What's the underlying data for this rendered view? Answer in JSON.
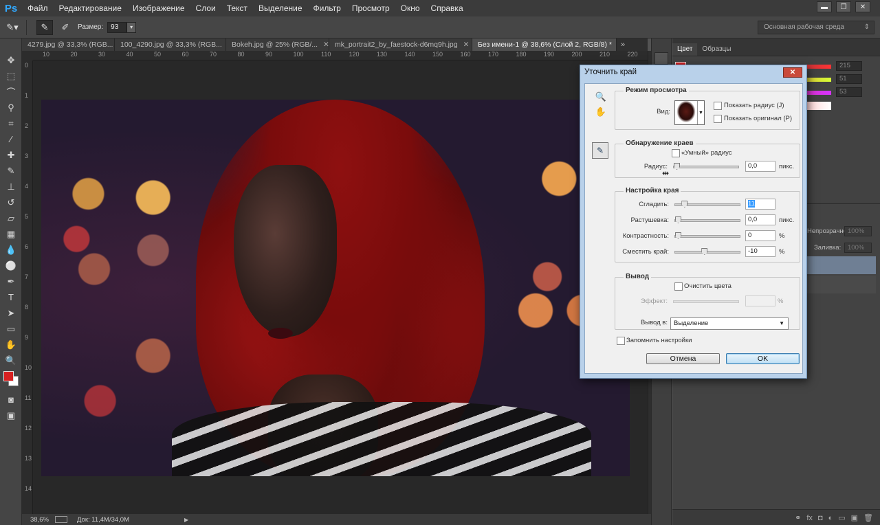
{
  "app": {
    "logo": "Ps",
    "menu": [
      "Файл",
      "Редактирование",
      "Изображение",
      "Слои",
      "Текст",
      "Выделение",
      "Фильтр",
      "Просмотр",
      "Окно",
      "Справка"
    ],
    "window_controls": [
      "▬",
      "❐",
      "✕"
    ]
  },
  "options_bar": {
    "size_label": "Размер:",
    "size_value": "93",
    "workspace": "Основная рабочая среда",
    "icons": [
      "brush-options-icon",
      "refine-radius-icon",
      "erase-refinements-icon"
    ]
  },
  "tabs": [
    {
      "label": "4279.jpg @ 33,3% (RGB...",
      "close": "✕"
    },
    {
      "label": "100_4290.jpg @ 33,3% (RGB...",
      "close": "✕"
    },
    {
      "label": "Bokeh.jpg @ 25% (RGB/...",
      "close": "✕"
    },
    {
      "label": "mk_portrait2_by_faestock-d6mq9h.jpg",
      "close": "✕"
    },
    {
      "label": "Без имени-1 @ 38,6% (Слой 2, RGB/8) *",
      "close": "✕"
    }
  ],
  "tabs_more": "»",
  "ruler_top_ticks": [
    "10",
    "20",
    "30",
    "40",
    "50",
    "60",
    "70",
    "80",
    "90",
    "100",
    "110",
    "120",
    "130",
    "140",
    "150",
    "160",
    "170",
    "180",
    "190",
    "200",
    "210",
    "220"
  ],
  "ruler_left_ticks": [
    "0",
    "1",
    "2",
    "3",
    "4",
    "5",
    "6",
    "7",
    "8",
    "9",
    "10",
    "11",
    "12",
    "13",
    "14"
  ],
  "status": {
    "zoom": "38,6%",
    "doc": "Док: 11,4M/34,0M",
    "arrow": "▶"
  },
  "panel": {
    "tabs": [
      "Цвет",
      "Образцы"
    ],
    "color_values": [
      "215",
      "51",
      "53"
    ],
    "opacity_label": "Непрозрачность:",
    "opacity_value": "100%",
    "fill_label": "Заливка:",
    "fill_value": "100%",
    "footer_icons": [
      "⚭",
      "fx",
      "◘",
      "◐",
      "▭",
      "▣",
      "🗑"
    ]
  },
  "dialog": {
    "title": "Уточнить край",
    "close": "✕",
    "view_mode": {
      "title": "Режим просмотра",
      "view_label": "Вид:",
      "show_radius": "Показать радиус (J)",
      "show_original": "Показать оригинал (P)"
    },
    "edge_detection": {
      "title": "Обнаружение краев",
      "smart_radius": "«Умный» радиус",
      "radius_label": "Радиус:",
      "radius_value": "0,0",
      "radius_unit": "пикс.",
      "radius_level": 0
    },
    "adjust_edge": {
      "title": "Настройка края",
      "rows": [
        {
          "label": "Сгладить:",
          "value": "11",
          "unit": "",
          "level": 0.11
        },
        {
          "label": "Растушевка:",
          "value": "0,0",
          "unit": "пикс.",
          "level": 0
        },
        {
          "label": "Контрастность:",
          "value": "0",
          "unit": "%",
          "level": 0
        },
        {
          "label": "Сместить край:",
          "value": "-10",
          "unit": "%",
          "level": 0.45
        }
      ]
    },
    "output": {
      "title": "Вывод",
      "decontaminate": "Очистить цвета",
      "amount_label": "Эффект:",
      "amount_unit": "%",
      "output_to_label": "Вывод в:",
      "output_to_value": "Выделение"
    },
    "remember": "Запомнить настройки",
    "cancel": "Отмена",
    "ok": "OK"
  }
}
